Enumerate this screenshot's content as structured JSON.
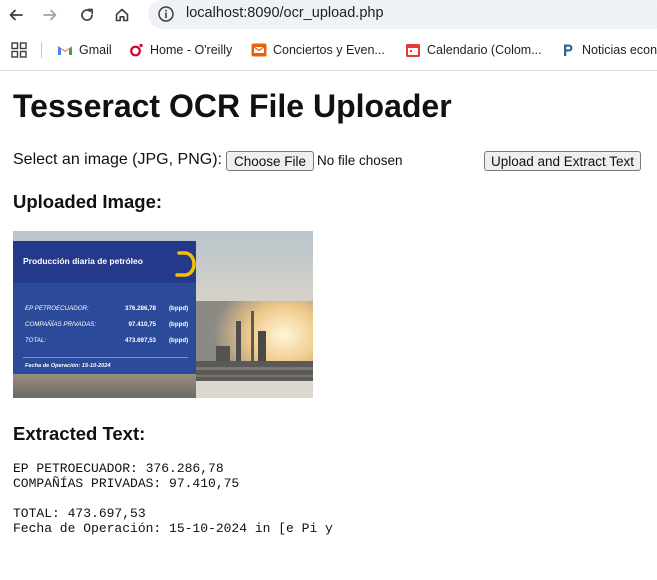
{
  "browser": {
    "url": "localhost:8090/ocr_upload.php",
    "bookmarks": [
      {
        "label": "Gmail",
        "icon": "gmail-icon"
      },
      {
        "label": "Home - O'reilly",
        "icon": "oreilly-icon"
      },
      {
        "label": "Conciertos y Even...",
        "icon": "envelope-icon"
      },
      {
        "label": "Calendario (Colom...",
        "icon": "calendar-icon"
      },
      {
        "label": "Noticias econ",
        "icon": "p-icon"
      }
    ]
  },
  "page": {
    "title": "Tesseract OCR File Uploader",
    "select_label": "Select an image (JPG, PNG):",
    "choose_file_button": "Choose File",
    "no_file_text": "No file chosen",
    "upload_button": "Upload and Extract Text",
    "uploaded_heading": "Uploaded Image:",
    "extracted_heading": "Extracted Text:"
  },
  "uploaded_image": {
    "title": "Producción diaria de petróleo",
    "rows": [
      {
        "label": "EP PETROECUADOR:",
        "value": "376.286,78",
        "unit": "(bppd)"
      },
      {
        "label": "COMPAÑÍAS PRIVADAS:",
        "value": "97.410,75",
        "unit": "(bppd)"
      },
      {
        "label": "TOTAL:",
        "value": "473.697,53",
        "unit": "(bppd)"
      }
    ],
    "date_text": "Fecha de Operación: 15-10-2024",
    "colors": {
      "panel": "#2c4a9a",
      "accent": "#f2c200"
    }
  },
  "extracted_text": [
    "EP PETROECUADOR: 376.286,78",
    "COMPAÑÍAS PRIVADAS: 97.410,75",
    "",
    "TOTAL: 473.697,53",
    "Fecha de Operación: 15-10-2024 in [e Pi y"
  ]
}
